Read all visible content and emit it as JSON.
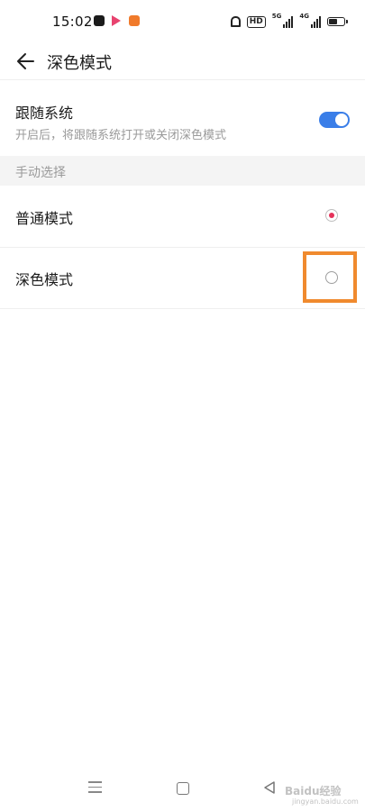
{
  "status_bar": {
    "time": "15:02",
    "hd_badge": "HD",
    "network_5g": "5G",
    "network_4g": "4G",
    "battery_level": 0.6,
    "icons": [
      "app-icon-dark",
      "app-icon-video",
      "app-icon-orange",
      "bell-muted-icon",
      "signal-icon",
      "battery-icon"
    ]
  },
  "header": {
    "back_icon": "arrow-left-icon",
    "title": "深色模式"
  },
  "follow_system": {
    "title": "跟随系统",
    "subtitle": "开启后，将跟随系统打开或关闭深色模式",
    "enabled": true
  },
  "manual_section": {
    "label": "手动选择",
    "options": [
      {
        "label": "普通模式",
        "selected": true
      },
      {
        "label": "深色模式",
        "selected": false
      }
    ]
  },
  "nav_bar": {
    "icons": [
      "menu-icon",
      "home-icon",
      "back-triangle-icon"
    ]
  },
  "watermark": {
    "text": "Baidu经验",
    "url": "jingyan.baidu.com"
  },
  "colors": {
    "toggle_on": "#3a7ee8",
    "radio_selected": "#e5325a",
    "highlight": "#f08a2e"
  }
}
